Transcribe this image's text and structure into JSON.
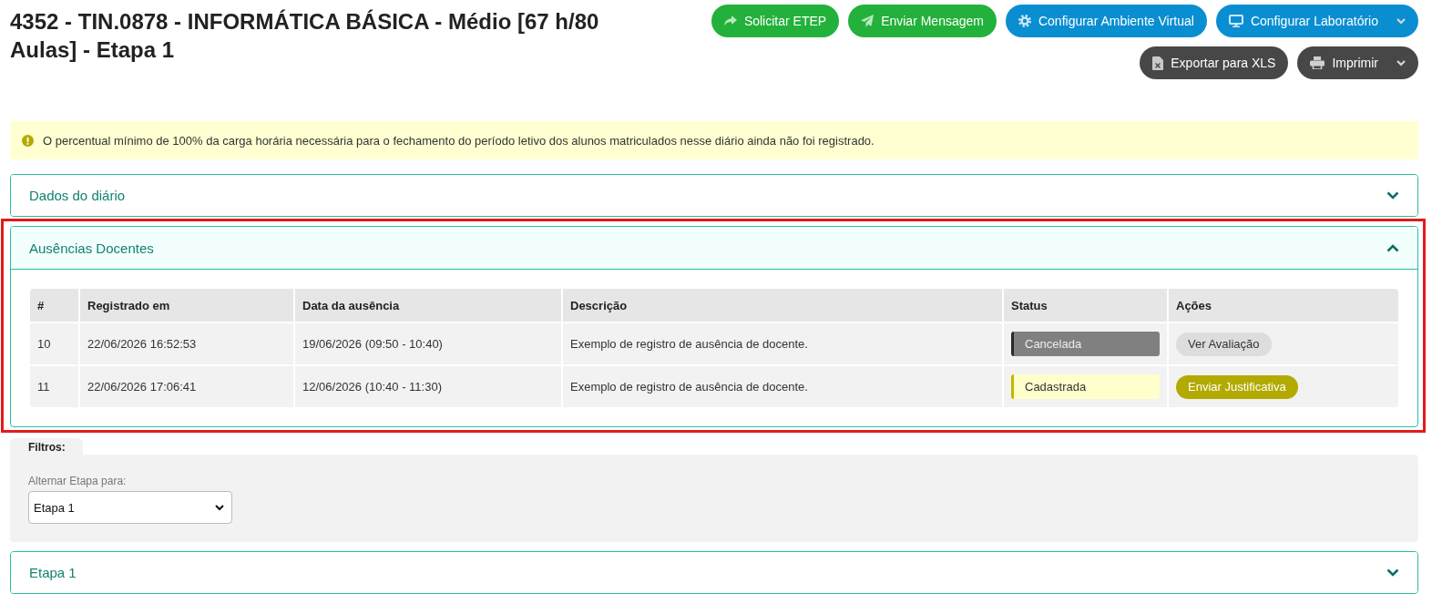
{
  "page": {
    "title": "4352 - TIN.0878 - INFORMÁTICA BÁSICA - Médio [67 h/80 Aulas] - Etapa 1"
  },
  "toolbar": {
    "rows": [
      {
        "buttons": [
          {
            "label": "Solicitar ETEP",
            "kind": "success",
            "dropdown": false
          },
          {
            "label": "Enviar Mensagem",
            "kind": "success",
            "dropdown": false
          },
          {
            "label": "Configurar Ambiente Virtual",
            "kind": "primary",
            "dropdown": false
          },
          {
            "label": "Configurar Laboratório",
            "kind": "primary",
            "dropdown": true
          }
        ]
      },
      {
        "buttons": [
          {
            "label": "Exportar para XLS",
            "kind": "dark",
            "dropdown": false
          },
          {
            "label": "Imprimir",
            "kind": "dark",
            "dropdown": true
          }
        ]
      }
    ]
  },
  "alert": {
    "kind": "warning",
    "text": "O percentual mínimo de 100% da carga horária necessária para o fechamento do período letivo dos alunos matriculados nesse diário ainda não foi registrado."
  },
  "sections": [
    {
      "kind": "accordion",
      "title": "Dados do diário",
      "expanded": false,
      "highlighted": false
    },
    {
      "kind": "accordion",
      "title": "Ausências Docentes",
      "expanded": true,
      "highlighted": true,
      "table": {
        "columns": [
          "#",
          "Registrado em",
          "Data da ausência",
          "Descrição",
          "Status",
          "Ações"
        ],
        "rows": [
          {
            "cells": [
              "10",
              "22/06/2026 16:52:53",
              "19/06/2026 (09:50 - 10:40)",
              "Exemplo de registro de ausência de docente."
            ],
            "status": {
              "label": "Cancelada",
              "kind": "cancelled"
            },
            "action": {
              "label": "Ver Avaliação",
              "kind": "neutral"
            }
          },
          {
            "cells": [
              "11",
              "22/06/2026 17:06:41",
              "12/06/2026 (10:40 - 11:30)",
              "Exemplo de registro de ausência de docente."
            ],
            "status": {
              "label": "Cadastrada",
              "kind": "registered"
            },
            "action": {
              "label": "Enviar Justificativa",
              "kind": "warning"
            }
          }
        ]
      }
    },
    {
      "kind": "filters",
      "tab_label": "Filtros:",
      "field_label": "Alternar Etapa para:",
      "select_value": "Etapa 1"
    },
    {
      "kind": "accordion",
      "title": "Etapa 1",
      "expanded": false,
      "highlighted": false
    }
  ]
}
